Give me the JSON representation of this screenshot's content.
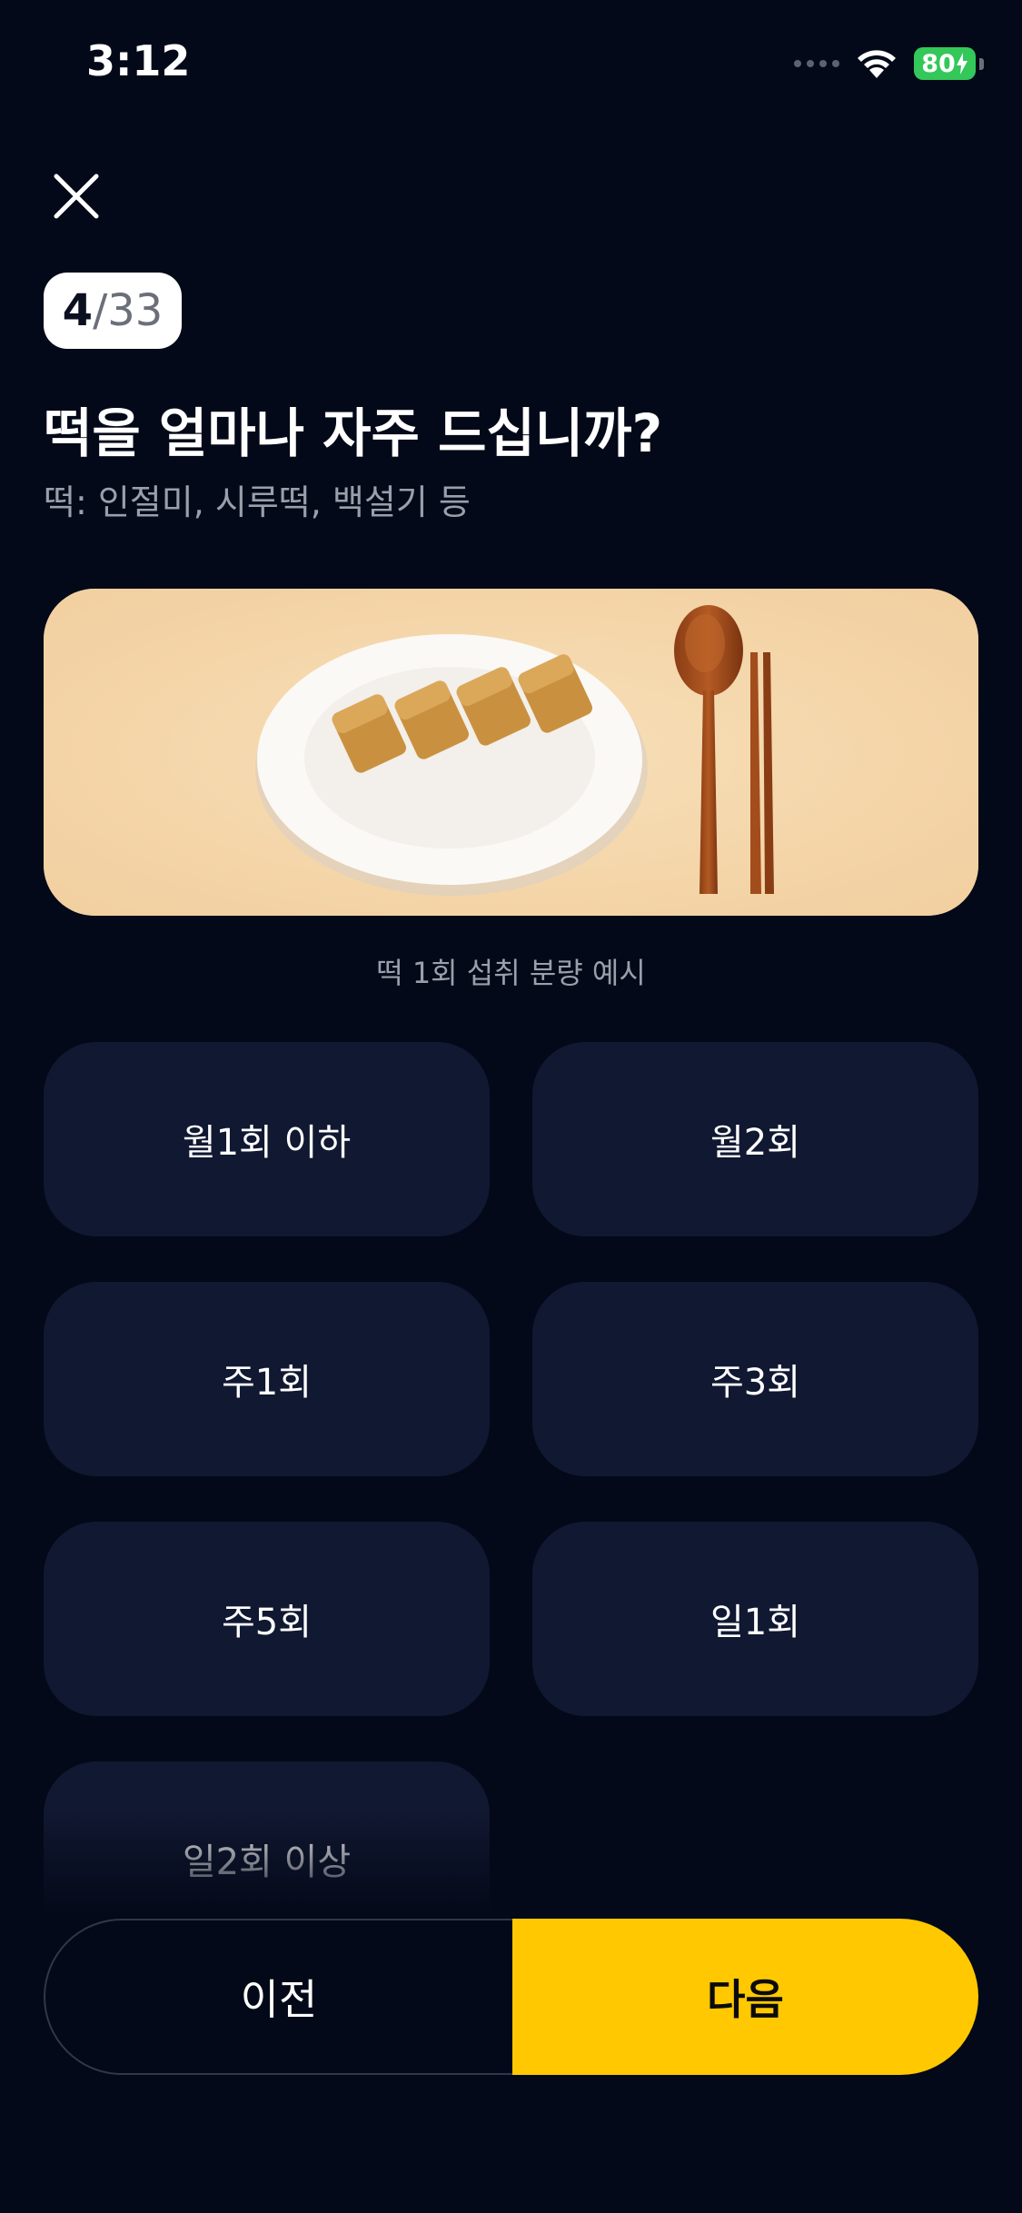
{
  "status_bar": {
    "time": "3:12",
    "battery": "80"
  },
  "progress": {
    "current": "4",
    "separator": "/",
    "total": "33"
  },
  "question": {
    "title": "떡을 얼마나 자주 드십니까?",
    "subtitle": "떡: 인절미, 시루떡, 백설기 등"
  },
  "image": {
    "caption": "떡 1회 섭취 분량 예시"
  },
  "options": [
    "월1회 이하",
    "월2회",
    "주1회",
    "주3회",
    "주5회",
    "일1회",
    "일2회 이상"
  ],
  "nav": {
    "prev_label": "이전",
    "next_label": "다음"
  },
  "colors": {
    "background": "#030918",
    "option_bg": "#111831",
    "accent": "#ffc800",
    "battery": "#34c759"
  },
  "icons": {
    "close": "close-icon",
    "wifi": "wifi-icon",
    "cellular": "cellular-signal-icon",
    "battery": "battery-charging-icon"
  }
}
